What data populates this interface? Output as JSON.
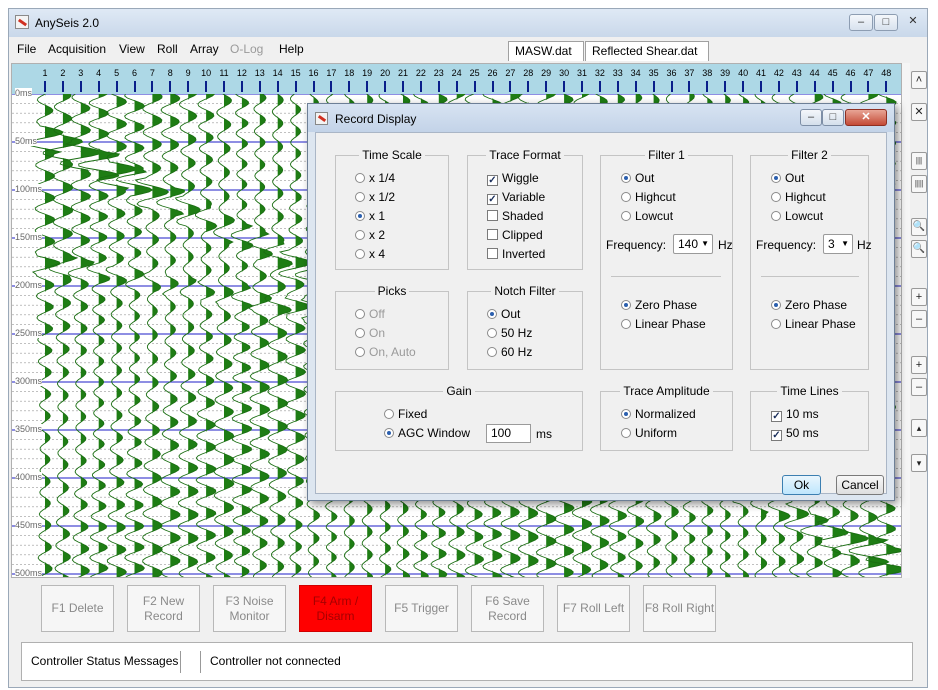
{
  "app": {
    "title": "AnySeis 2.0",
    "window_minimize": "–",
    "window_maximize": "□",
    "window_close": "✕"
  },
  "menu": [
    "File",
    "Acquisition",
    "View",
    "Roll",
    "Array",
    "O-Log",
    "Help"
  ],
  "menu_disabled": [
    "O-Log"
  ],
  "tabs": [
    {
      "label": "MASW.dat"
    },
    {
      "label": "Reflected Shear.dat"
    }
  ],
  "ruler": {
    "labels": [
      "1",
      "2",
      "3",
      "4",
      "5",
      "6",
      "7",
      "8",
      "9",
      "10",
      "11",
      "12",
      "13",
      "14",
      "15",
      "16",
      "17",
      "18",
      "19",
      "20",
      "21",
      "22",
      "23",
      "24",
      "25",
      "26",
      "27",
      "28",
      "29",
      "30",
      "31",
      "32",
      "33",
      "34",
      "35",
      "36",
      "37",
      "38",
      "39",
      "40",
      "41",
      "42",
      "43",
      "44",
      "45",
      "46",
      "47",
      "48"
    ]
  },
  "time_axis": {
    "labels": [
      "0ms",
      "50ms",
      "100ms",
      "150ms",
      "200ms",
      "250ms",
      "300ms",
      "350ms",
      "400ms",
      "450ms",
      "500ms"
    ]
  },
  "colors": {
    "trace_fill": "#1e7d14",
    "trace_line": "#1a6e12",
    "ruler": "#add8e6",
    "timeline": "#4b4bd2",
    "f4_active": "#ff0000"
  },
  "side_toolbar": [
    "˄",
    "✕",
    "|||",
    "||||",
    "🔍",
    "🔍",
    "+",
    "–",
    "+",
    "–",
    "▴",
    "▾"
  ],
  "function_keys": [
    {
      "label": "F1 Delete",
      "active": false
    },
    {
      "label": "F2 New\nRecord",
      "active": false
    },
    {
      "label": "F3 Noise\nMonitor",
      "active": false
    },
    {
      "label": "F4 Arm /\nDisarm",
      "active": true
    },
    {
      "label": "F5 Trigger",
      "active": false
    },
    {
      "label": "F6 Save\nRecord",
      "active": false
    },
    {
      "label": "F7 Roll Left",
      "active": false
    },
    {
      "label": "F8 Roll Right",
      "active": false
    }
  ],
  "status": {
    "label": "Controller Status Messages",
    "message": "Controller not connected"
  },
  "dialog": {
    "title": "Record Display",
    "time_scale": {
      "title": "Time Scale",
      "options": [
        "x 1/4",
        "x 1/2",
        "x 1",
        "x 2",
        "x 4"
      ],
      "selected": "x 1"
    },
    "trace_format": {
      "title": "Trace Format",
      "options": [
        {
          "label": "Wiggle",
          "checked": true
        },
        {
          "label": "Variable",
          "checked": true
        },
        {
          "label": "Shaded",
          "checked": false
        },
        {
          "label": "Clipped",
          "checked": false
        },
        {
          "label": "Inverted",
          "checked": false
        }
      ]
    },
    "filter1": {
      "title": "Filter 1",
      "options": [
        "Out",
        "Highcut",
        "Lowcut"
      ],
      "selected": "Out",
      "frequency_label": "Frequency:",
      "frequency": "140",
      "unit": "Hz",
      "phase": [
        "Zero Phase",
        "Linear Phase"
      ],
      "phase_selected": "Zero Phase"
    },
    "filter2": {
      "title": "Filter 2",
      "options": [
        "Out",
        "Highcut",
        "Lowcut"
      ],
      "selected": "Out",
      "frequency_label": "Frequency:",
      "frequency": "3",
      "unit": "Hz",
      "phase": [
        "Zero Phase",
        "Linear Phase"
      ],
      "phase_selected": "Zero Phase"
    },
    "picks": {
      "title": "Picks",
      "options": [
        "Off",
        "On",
        "On, Auto"
      ],
      "selected": "Off"
    },
    "notch": {
      "title": "Notch Filter",
      "options": [
        "Out",
        "50 Hz",
        "60 Hz"
      ],
      "selected": "Out"
    },
    "gain": {
      "title": "Gain",
      "options": [
        "Fixed",
        "AGC Window"
      ],
      "selected": "AGC Window",
      "agc_value": "100",
      "agc_unit": "ms"
    },
    "trace_amplitude": {
      "title": "Trace Amplitude",
      "options": [
        "Normalized",
        "Uniform"
      ],
      "selected": "Normalized"
    },
    "time_lines": {
      "title": "Time Lines",
      "options": [
        {
          "label": "10 ms",
          "checked": true
        },
        {
          "label": "50 ms",
          "checked": true
        }
      ]
    },
    "ok_label": "Ok",
    "cancel_label": "Cancel"
  }
}
